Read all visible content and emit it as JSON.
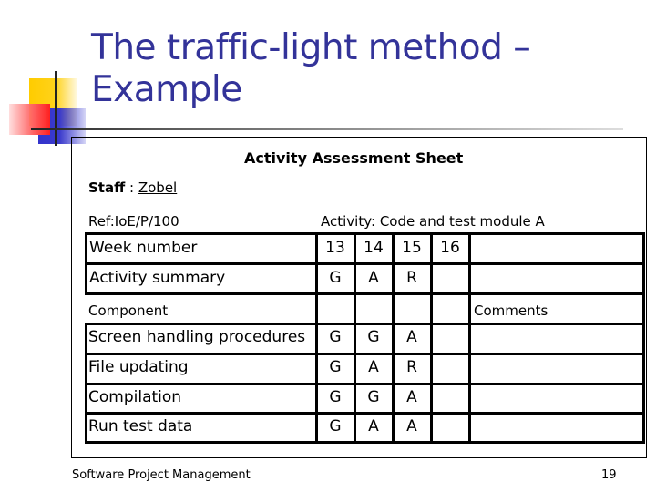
{
  "slide": {
    "title_line1": "The traffic-light method –",
    "title_line2": "Example",
    "title_color": "#333399"
  },
  "sheet": {
    "heading": "Activity Assessment Sheet",
    "staff_label": "Staff",
    "staff_sep": " : ",
    "staff_value": "Zobel",
    "ref": "Ref:IoE/P/100",
    "activity": "Activity: Code and test module A",
    "week_row": {
      "label": "Week number",
      "values": [
        "13",
        "14",
        "15",
        "16"
      ]
    },
    "summary_row": {
      "label": "Activity summary",
      "values": [
        "G",
        "A",
        "R",
        ""
      ]
    },
    "component_label": "Component",
    "comments_label": "Comments",
    "components": [
      {
        "name": "Screen handling procedures",
        "values": [
          "G",
          "G",
          "A",
          ""
        ]
      },
      {
        "name": "File updating",
        "values": [
          "G",
          "A",
          "R",
          ""
        ]
      },
      {
        "name": "Compilation",
        "values": [
          "G",
          "G",
          "A",
          ""
        ]
      },
      {
        "name": "Run test data",
        "values": [
          "G",
          "A",
          "A",
          ""
        ]
      }
    ]
  },
  "footer": {
    "course": "Software Project Management",
    "page_number": "19"
  }
}
